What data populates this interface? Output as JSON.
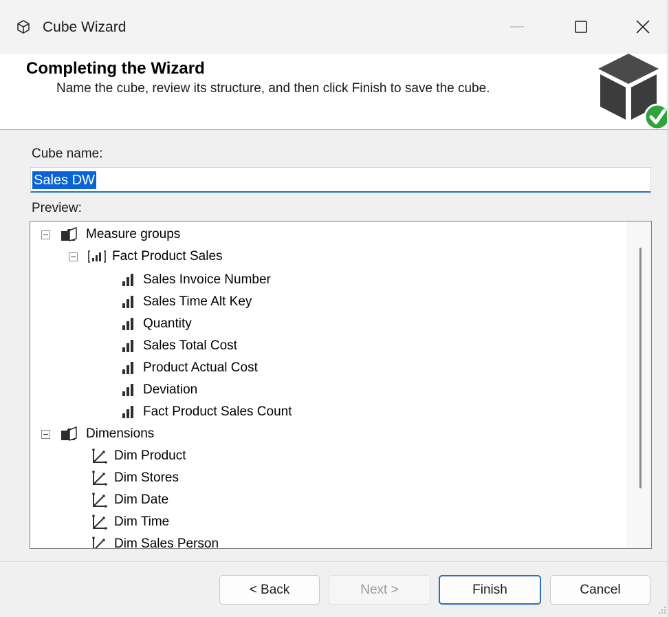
{
  "window": {
    "title": "Cube Wizard",
    "controls": {
      "minimize": "minimize-icon",
      "maximize": "maximize-icon",
      "close": "close-icon"
    }
  },
  "header": {
    "title": "Completing the Wizard",
    "subtitle": "Name the cube, review its structure, and then click Finish to save the cube.",
    "graphic": "cube-check-icon"
  },
  "cube_name": {
    "label": "Cube name:",
    "value": "Sales DW"
  },
  "preview": {
    "label": "Preview:",
    "tree": {
      "measure_groups": {
        "label": "Measure groups",
        "groups": [
          {
            "label": "Fact Product Sales",
            "measures": [
              "Sales Invoice Number",
              "Sales Time Alt Key",
              "Quantity",
              "Sales Total Cost",
              "Product Actual Cost",
              "Deviation",
              "Fact Product Sales Count"
            ]
          }
        ]
      },
      "dimensions": {
        "label": "Dimensions",
        "items": [
          "Dim Product",
          "Dim Stores",
          "Dim Date",
          "Dim Time",
          "Dim Sales Person"
        ]
      }
    }
  },
  "buttons": {
    "back": "< Back",
    "next": "Next >",
    "finish": "Finish",
    "cancel": "Cancel"
  },
  "colors": {
    "accent": "#2b6fbd",
    "selection": "#0a64d6",
    "check_green": "#2fa43b",
    "cube_dark": "#3c3c3c"
  }
}
